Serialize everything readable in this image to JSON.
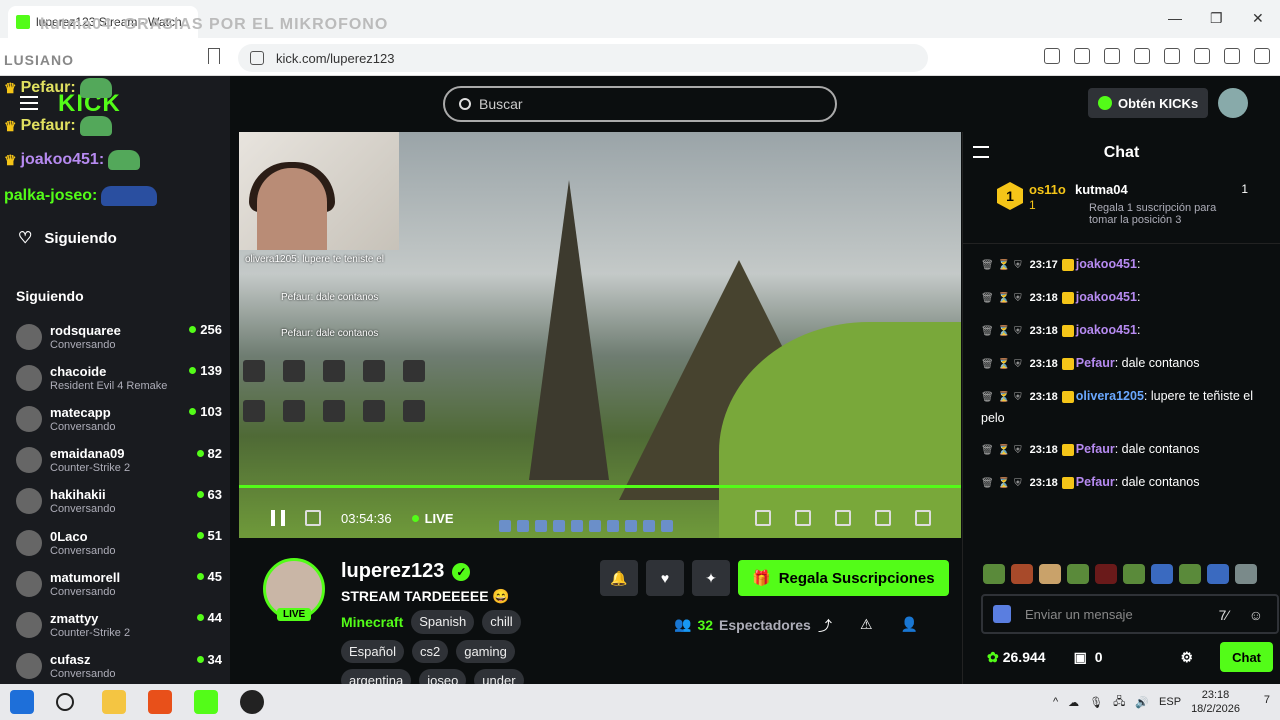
{
  "browser": {
    "tab_title": "luperez123 Stream - Watch",
    "overlay_text": "kutma04: GRASIAS POR EL MIKROFONO",
    "overlay_text2": "LUSIANO",
    "url": "kick.com/luperez123"
  },
  "overlays": {
    "line1": "Pefaur:",
    "line2": "Pefaur:",
    "line3": "joakoo451:",
    "line4": "palka-joseo:"
  },
  "sidebar": {
    "brand": "KICK",
    "following_label": "Siguiendo",
    "section_title": "Siguiendo",
    "channels": [
      {
        "name": "rodsquaree",
        "sub": "Conversando",
        "count": "256"
      },
      {
        "name": "chacoide",
        "sub": "Resident Evil 4 Remake",
        "count": "139"
      },
      {
        "name": "matecapp",
        "sub": "Conversando",
        "count": "103"
      },
      {
        "name": "emaidana09",
        "sub": "Counter-Strike 2",
        "count": "82"
      },
      {
        "name": "hakihakii",
        "sub": "Conversando",
        "count": "63"
      },
      {
        "name": "0Laco",
        "sub": "Conversando",
        "count": "51"
      },
      {
        "name": "matumorell",
        "sub": "Conversando",
        "count": "45"
      },
      {
        "name": "zmattyy",
        "sub": "Counter-Strike 2",
        "count": "44"
      },
      {
        "name": "cufasz",
        "sub": "Conversando",
        "count": "34"
      }
    ]
  },
  "header": {
    "search_placeholder": "Buscar",
    "kicks_button": "Obtén KICKs"
  },
  "video": {
    "time": "03:54:36",
    "live_label": "LIVE",
    "overlay_chat1": "olivera1205: lupere te teniste el",
    "overlay_chat2": "Pefaur: dale contanos",
    "overlay_chat3": "Pefaur: dale contanos"
  },
  "streamer": {
    "name": "luperez123",
    "live_tag": "LIVE",
    "title": "STREAM TARDEEEEE 😄",
    "category": "Minecraft",
    "tags": [
      "Spanish",
      "chill",
      "Español",
      "cs2",
      "gaming",
      "argentina",
      "joseo",
      "under"
    ],
    "gift_button": "Regala Suscripciones",
    "viewers_count": "32",
    "viewers_label": "Espectadores"
  },
  "chat": {
    "title": "Chat",
    "leaderboard": {
      "rank": "1",
      "user1": "os11o",
      "user1_count": "1",
      "user2": "kutma04",
      "user2_count": "1",
      "description": "Regala 1 suscripción para tomar la posición 3"
    },
    "messages": [
      {
        "time": "23:17",
        "user": "joakoo451",
        "text": "",
        "color": "purple"
      },
      {
        "time": "23:18",
        "user": "joakoo451",
        "text": "",
        "color": "purple"
      },
      {
        "time": "23:18",
        "user": "joakoo451",
        "text": "",
        "color": "purple"
      },
      {
        "time": "23:18",
        "user": "Pefaur",
        "text": "dale contanos",
        "color": "purple"
      },
      {
        "time": "23:18",
        "user": "olivera1205",
        "text": "lupere te teñiste el pelo",
        "color": "blue"
      },
      {
        "time": "23:18",
        "user": "Pefaur",
        "text": "dale contanos",
        "color": "purple"
      },
      {
        "time": "23:18",
        "user": "Pefaur",
        "text": "dale contanos",
        "color": "purple"
      }
    ],
    "input_placeholder": "Enviar un mensaje",
    "kicks_balance": "26.944",
    "gift_count": "0",
    "send_button": "Chat"
  },
  "taskbar": {
    "language": "ESP",
    "time": "23:18",
    "date": "18/2/2026",
    "notifications": "7"
  },
  "colors": {
    "accent": "#53fc18",
    "background": "#0b0e0f",
    "sidebar": "#191b1f"
  }
}
